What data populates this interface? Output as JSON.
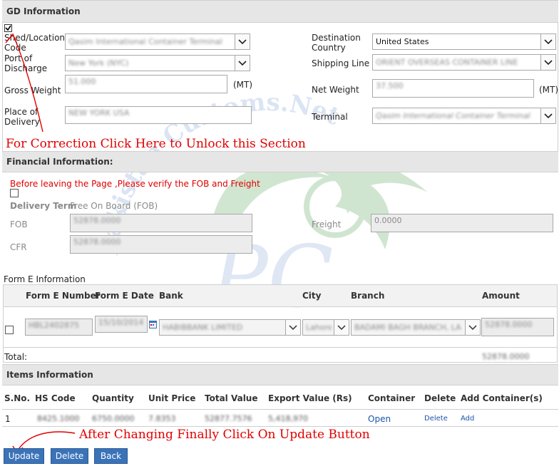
{
  "gd": {
    "title": "GD Information",
    "shed_label": "Shed/Location Code",
    "shed_value": "Qasim International Container Terminal",
    "port_label": "Port of Discharge",
    "port_value": "New York (NYC)",
    "gross_label": "Gross Weight",
    "gross_value": "51.000",
    "gross_unit": "(MT)",
    "place_label": "Place of Delivery",
    "place_value": "NEW YORK USA",
    "dest_label": "Destination Country",
    "dest_value": "United States",
    "shipping_label": "Shipping Line",
    "shipping_value": "ORIENT OVERSEAS CONTAINER LINE",
    "net_label": "Net Weight",
    "net_value": "37.500",
    "net_unit": "(MT)",
    "terminal_label": "Terminal",
    "terminal_value": "Qasim International Container Terminal"
  },
  "annotation_unlock": "For Correction Click Here to Unlock this Section",
  "financial": {
    "title": "Financial Information:",
    "warning": "Before leaving the Page ,Please verify the FOB and Freight",
    "delivery_term_label": "Delivery Term",
    "delivery_term_value": "Free On Board (FOB)",
    "fob_label": "FOB",
    "fob_value": "52878.0000",
    "cfr_label": "CFR",
    "cfr_value": "52878.0000",
    "freight_label": "Freight",
    "freight_value": "0.0000"
  },
  "forme": {
    "title": "Form E Information",
    "headers": [
      "Form E Number",
      "Form E Date",
      "Bank",
      "City",
      "Branch",
      "Amount"
    ],
    "row": {
      "number": "HBL2402875",
      "date": "15/10/2014",
      "bank": "HABIBBANK LIMITED",
      "city": "Lahore",
      "branch": "BADAMI BAGH BRANCH, LA",
      "amount": "52878.0000"
    },
    "total_label": "Total:",
    "total_value": "52878.0000"
  },
  "items": {
    "title": "Items Information",
    "headers": [
      "S.No.",
      "HS Code",
      "Quantity",
      "Unit Price",
      "Total Value",
      "Export Value (Rs)",
      "Container",
      "Delete",
      "Add Container(s)"
    ],
    "row": {
      "sno": "1",
      "hs": "8425.1000",
      "qty": "6750.0000",
      "unit": "7.8353",
      "total": "52877.7576",
      "export": "5,418,970",
      "container": "Open",
      "delete": "Delete",
      "add": "Add"
    }
  },
  "annotation_update": "After Changing Finally Click On Update Button",
  "buttons": {
    "update": "Update",
    "delete": "Delete",
    "back": "Back"
  },
  "watermark": "Pakistan Customs.Net",
  "watermark_logo": "PC",
  "colors": {
    "annotation": "#e00000",
    "button": "#3b73b9",
    "section": "#e6e6e6",
    "link": "#1a55a8"
  }
}
